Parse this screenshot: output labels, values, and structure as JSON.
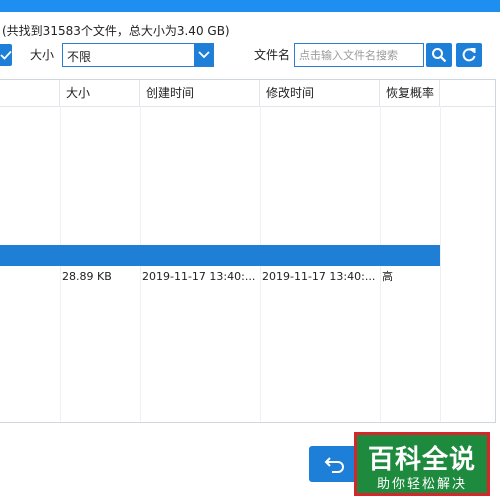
{
  "summary_text": "(共找到31583个文件，总大小为3.40 GB)",
  "filter": {
    "size_label": "大小",
    "size_value": "不限",
    "filename_label": "文件名",
    "filename_placeholder": "点击输入文件名搜索"
  },
  "table": {
    "columns": [
      "大小",
      "创建时间",
      "修改时间",
      "恢复概率"
    ],
    "rows": [
      {
        "size": "28.89 KB",
        "created": "2019-11-17 13:40:...",
        "modified": "2019-11-17 13:40:...",
        "probability": "高"
      }
    ]
  },
  "watermark": {
    "main": "百科全说",
    "sub": "助你轻松解决"
  },
  "colors": {
    "accent": "#1e7fd8",
    "selection": "#1f7fd4",
    "watermark_bg": "#1d8a3d",
    "watermark_border": "#d6262b"
  },
  "icons": {
    "search": "search-icon",
    "refresh": "refresh-icon",
    "back": "undo-arrow-icon",
    "dropdown": "chevron-down-icon",
    "checkbox": "check-icon"
  }
}
